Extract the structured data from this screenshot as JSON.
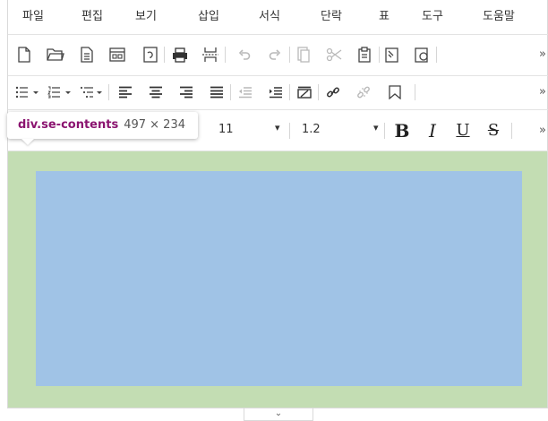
{
  "menubar": {
    "items": [
      "파일",
      "편집",
      "보기",
      "삽입",
      "서식",
      "단락",
      "표",
      "도구",
      "도움말"
    ]
  },
  "toolbar": {
    "more_glyph": "»"
  },
  "font_row": {
    "font_size": "11",
    "line_height": "1.2",
    "dropdown_glyph": "▾",
    "bold_label": "B",
    "italic_label": "I",
    "underline_label": "U",
    "strike_label": "S"
  },
  "inspector": {
    "tag": "div.se-contents",
    "size": "497 × 234"
  },
  "resize_handle": {
    "glyph": "⌄"
  },
  "colors": {
    "padding_green": "#c3ddb3",
    "content_blue": "#a0c3e6",
    "tooltip_tag": "#8b1470"
  }
}
